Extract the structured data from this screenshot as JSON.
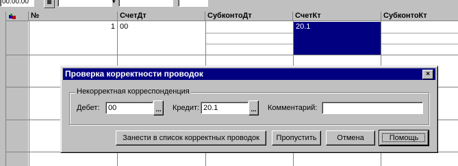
{
  "toolbar": {
    "field1_value": "00.00.00",
    "calendar_icon": "calendar-icon"
  },
  "grid": {
    "columns": [
      "№",
      "СчетДт",
      "СубконтоДт",
      "СчетКт",
      "СубконтоКт"
    ],
    "rows": [
      {
        "num": "1",
        "schet_dt": "00",
        "subkonto_dt": "",
        "schet_kt": "20.1",
        "subkonto_kt": ""
      }
    ],
    "row_icon": "entry-row-icon",
    "selection_color": "#000080"
  },
  "dialog": {
    "title": "Проверка корректности проводок",
    "close_label": "×",
    "group_title": "Некорректная корреспонденция",
    "debit_label": "Дебет:",
    "debit_value": "00",
    "credit_label": "Кредит:",
    "credit_value": "20.1",
    "comment_label": "Комментарий:",
    "comment_value": "",
    "picker_label": "...",
    "buttons": {
      "add_to_correct": "Занести в список корректных проводок",
      "skip": "Пропустить",
      "cancel": "Отмена",
      "help": "Помощь"
    }
  },
  "colors": {
    "face": "#c0c0c0",
    "titlebar": "#000080"
  }
}
